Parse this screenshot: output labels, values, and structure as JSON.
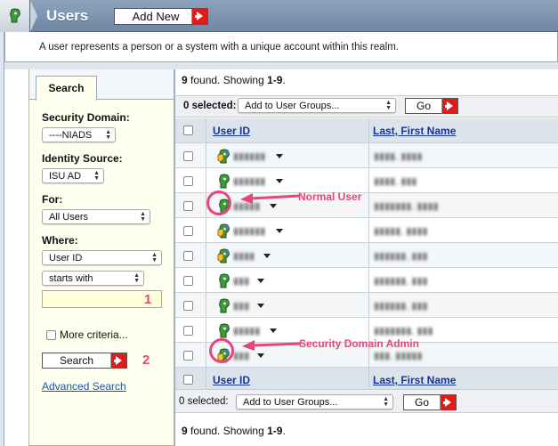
{
  "header": {
    "title": "Users",
    "add_new_label": "Add New"
  },
  "description": "A user represents a person or a system with a unique account within this realm.",
  "sidebar": {
    "tab_label": "Search",
    "security_domain": {
      "label": "Security Domain:",
      "value": "----NIADS"
    },
    "identity_source": {
      "label": "Identity Source:",
      "value": "ISU AD"
    },
    "for": {
      "label": "For:",
      "value": "All Users"
    },
    "where": {
      "label": "Where:",
      "field_value": "User ID",
      "operator_value": "starts with",
      "search_value": ""
    },
    "more_criteria_label": "More criteria...",
    "search_button_label": "Search",
    "advanced_search_label": "Advanced Search"
  },
  "results": {
    "found_top": {
      "count": "9",
      "mid": " found. Showing ",
      "range": "1-9",
      "end": "."
    },
    "found_bottom": {
      "count": "9",
      "mid": " found. Showing ",
      "range": "1-9",
      "end": "."
    },
    "top_toolbar": {
      "selected_label": "0 selected:",
      "action_value": "Add to User Groups...",
      "go_label": "Go"
    },
    "bottom_toolbar": {
      "selected_label": "0 selected:",
      "action_value": "Add to User Groups...",
      "go_label": "Go"
    },
    "columns": {
      "user_id": "User ID",
      "name": "Last, First Name"
    },
    "rows": [
      {
        "user_id": "▮▮▮▮▮▮",
        "name": "▮▮▮▮, ▮▮▮▮",
        "role": "admin"
      },
      {
        "user_id": "▮▮▮▮▮▮",
        "name": "▮▮▮▮, ▮▮▮",
        "role": "normal"
      },
      {
        "user_id": "▮▮▮▮▮",
        "name": "▮▮▮▮▮▮▮, ▮▮▮▮",
        "role": "normal"
      },
      {
        "user_id": "▮▮▮▮▮▮",
        "name": "▮▮▮▮▮, ▮▮▮▮",
        "role": "admin"
      },
      {
        "user_id": "▮▮▮▮",
        "name": "▮▮▮▮▮▮, ▮▮▮",
        "role": "admin"
      },
      {
        "user_id": "▮▮▮",
        "name": "▮▮▮▮▮▮, ▮▮▮",
        "role": "normal"
      },
      {
        "user_id": "▮▮▮",
        "name": "▮▮▮▮▮▮, ▮▮▮",
        "role": "normal"
      },
      {
        "user_id": "▮▮▮▮▮",
        "name": "▮▮▮▮▮▮▮, ▮▮▮",
        "role": "normal"
      },
      {
        "user_id": "▮▮▮",
        "name": "▮▮▮, ▮▮▮▮▮",
        "role": "admin"
      }
    ]
  },
  "annotations": {
    "normal_user": "Normal User",
    "security_domain_admin": "Security Domain Admin",
    "marker_1": "1",
    "marker_2": "2"
  },
  "colors": {
    "accent_red": "#e11a1a",
    "annotation_pink": "#e8457a",
    "link_blue": "#12359c",
    "header_blue": "#7a90aa"
  },
  "icons": [
    "user-icon",
    "security-admin-icon",
    "menu-arrow-icon",
    "go-arrow-icon"
  ]
}
